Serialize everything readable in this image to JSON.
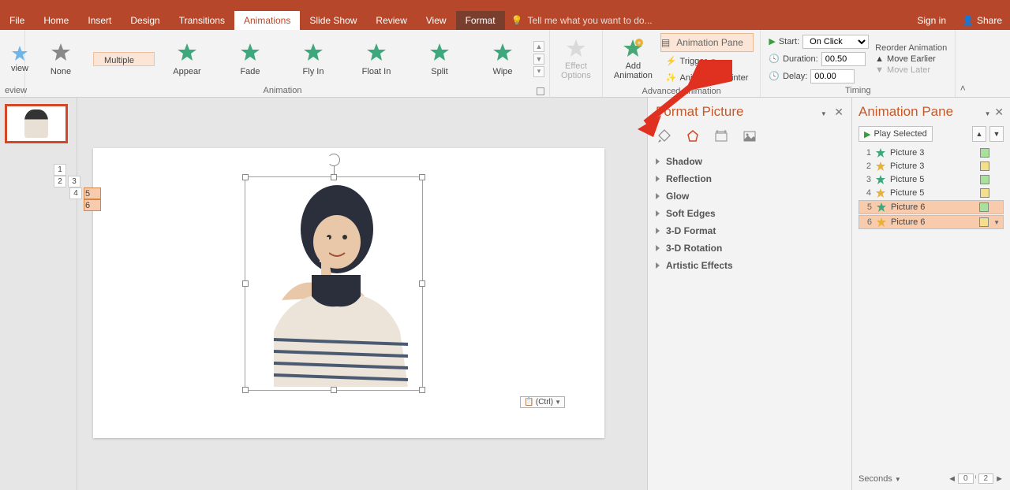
{
  "tabs": [
    "File",
    "Home",
    "Insert",
    "Design",
    "Transitions",
    "Animations",
    "Slide Show",
    "Review",
    "View",
    "Format"
  ],
  "active_tab": "Animations",
  "tellme": "Tell me what you want to do...",
  "signin": "Sign in",
  "share": "Share",
  "gallery": {
    "items": [
      {
        "label": "None",
        "color": "#898989"
      },
      {
        "label": "Multiple",
        "color": "#3a73c7"
      },
      {
        "label": "Appear",
        "color": "#3da87d"
      },
      {
        "label": "Fade",
        "color": "#3da87d"
      },
      {
        "label": "Fly In",
        "color": "#3da87d"
      },
      {
        "label": "Float In",
        "color": "#3da87d"
      },
      {
        "label": "Split",
        "color": "#3da87d"
      },
      {
        "label": "Wipe",
        "color": "#3da87d"
      }
    ],
    "group_label": "Animation"
  },
  "effect_options": "Effect\nOptions",
  "add_animation": "Add\nAnimation",
  "adv": {
    "pane": "Animation Pane",
    "trigger": "Trigger",
    "painter": "Animation Painter",
    "label": "Advanced Animation"
  },
  "timing": {
    "start_lbl": "Start:",
    "start_val": "On Click",
    "duration_lbl": "Duration:",
    "duration_val": "00.50",
    "delay_lbl": "Delay:",
    "delay_val": "00.00",
    "label": "Timing"
  },
  "reorder": {
    "title": "Reorder Animation",
    "earlier": "Move Earlier",
    "later": "Move Later"
  },
  "review_left": "view",
  "review_bottom": "eview",
  "animation_tags": [
    [
      "1",
      "2"
    ],
    [
      "3",
      "4"
    ],
    [
      "5"
    ],
    [
      "6"
    ]
  ],
  "ctrl": "(Ctrl)",
  "format_picture": {
    "title": "Format Picture",
    "sections": [
      "Shadow",
      "Reflection",
      "Glow",
      "Soft Edges",
      "3-D Format",
      "3-D Rotation",
      "Artistic Effects"
    ]
  },
  "animation_pane": {
    "title": "Animation Pane",
    "play": "Play Selected",
    "items": [
      {
        "n": "1",
        "star": "#3da87d",
        "name": "Picture 3",
        "bar": "#a8e29a"
      },
      {
        "n": "2",
        "star": "#e8b13a",
        "name": "Picture 3",
        "bar": "#f4df8c"
      },
      {
        "n": "3",
        "star": "#3da87d",
        "name": "Picture 5",
        "bar": "#a8e29a"
      },
      {
        "n": "4",
        "star": "#e8b13a",
        "name": "Picture 5",
        "bar": "#f4df8c"
      },
      {
        "n": "5",
        "star": "#3da87d",
        "name": "Picture 6",
        "bar": "#a8e29a",
        "sel": true
      },
      {
        "n": "6",
        "star": "#e8b13a",
        "name": "Picture 6",
        "bar": "#f4df8c",
        "sel": true
      }
    ],
    "seconds": "Seconds",
    "pos": "0",
    "total": "2"
  }
}
